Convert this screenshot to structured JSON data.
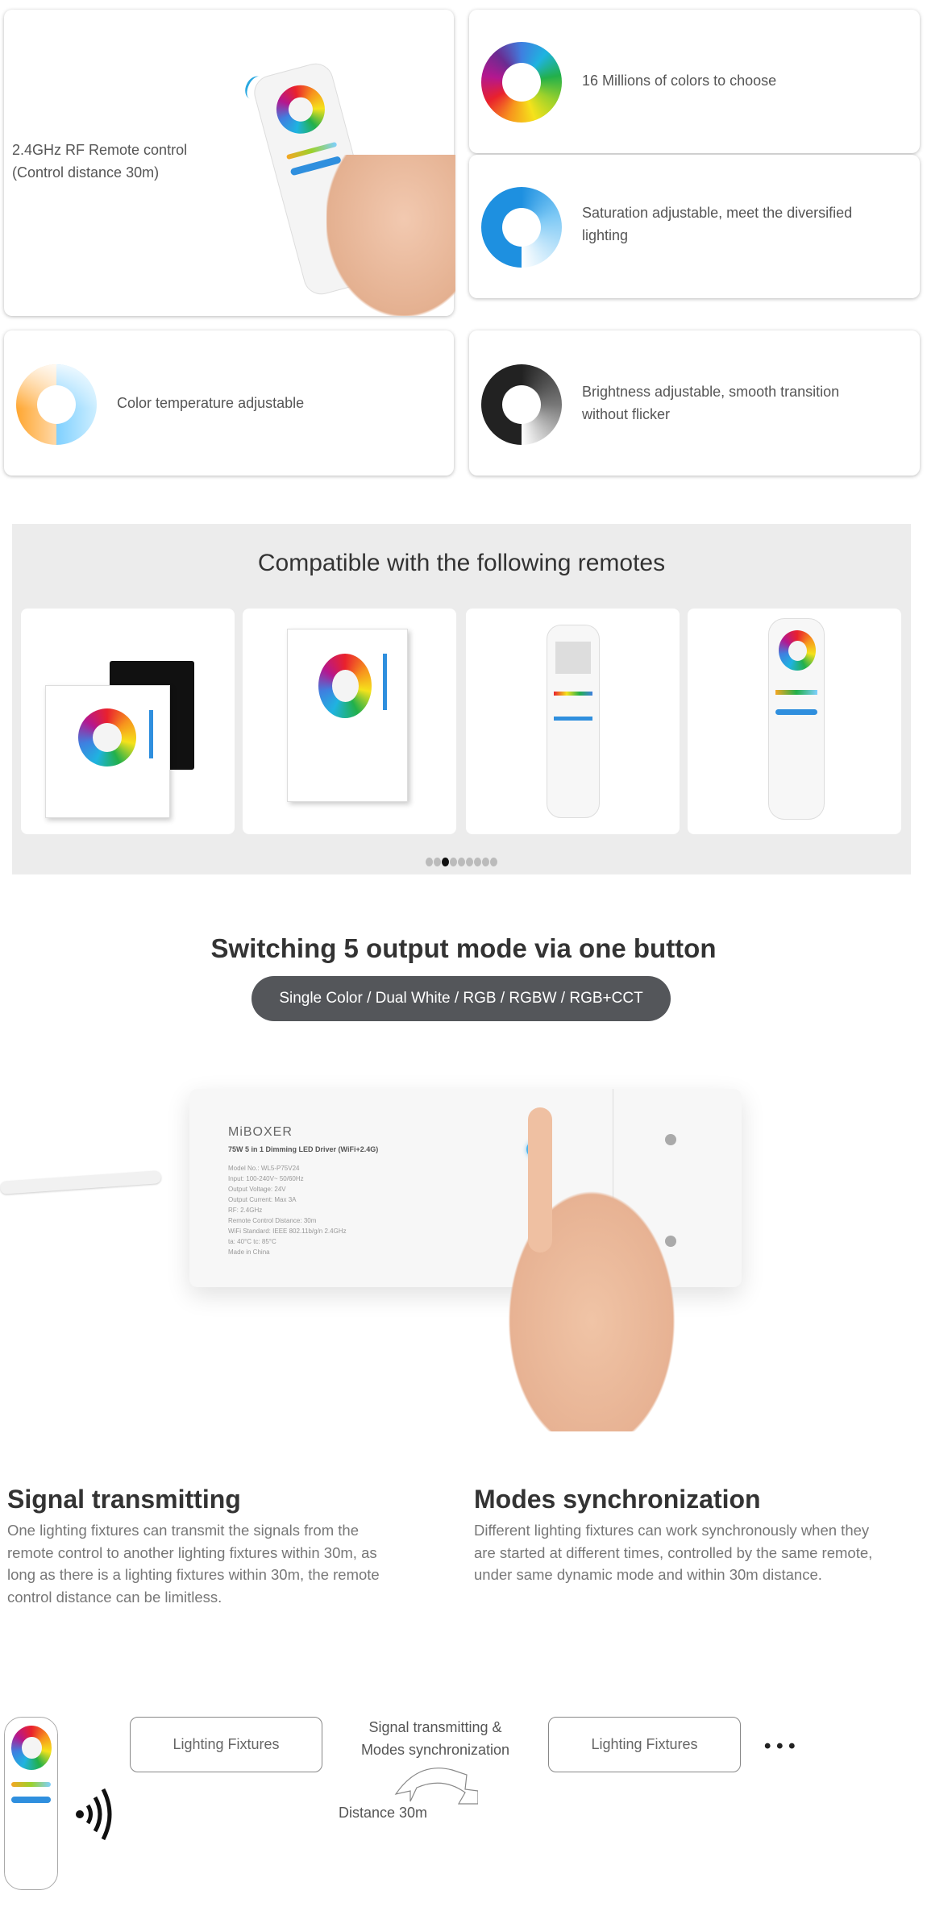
{
  "features": [
    {
      "text_line1": "2.4GHz RF Remote control",
      "text_line2": "(Control distance 30m)",
      "icon": "remote-hand-image"
    },
    {
      "text": "16 Millions of colors to choose",
      "icon": "rgb-color-ring-icon"
    },
    {
      "text_line1": "Saturation adjustable, meet the diversified",
      "text_line2": "lighting",
      "icon": "saturation-ring-icon"
    },
    {
      "text": "Color temperature adjustable",
      "icon": "color-temperature-ring-icon"
    },
    {
      "text_line1": "Brightness adjustable, smooth transition",
      "text_line2": "without flicker",
      "icon": "brightness-ring-icon"
    }
  ],
  "compatible": {
    "title": "Compatible with the following remotes",
    "total_slides": 9,
    "active_slide": 3
  },
  "modes": {
    "title": "Switching 5 output mode via one button",
    "pill": "Single Color / Dual White / RGB / RGBW / RGB+CCT"
  },
  "product": {
    "brand": "MiBOXER",
    "model_title": "75W 5 in 1 Dimming LED Driver (WiFi+2.4G)",
    "specs": [
      "Model No.: WL5-P75V24",
      "Input: 100-240V~ 50/60Hz",
      "Output Voltage: 24V",
      "Output Current: Max 3A",
      "RF: 2.4GHz",
      "Remote Control Distance: 30m",
      "WiFi Standard: IEEE 802.11b/g/n 2.4GHz",
      "ta: 40°C  tc: 85°C",
      "Made in China"
    ]
  },
  "signal": {
    "title": "Signal transmitting",
    "lines": [
      "One lighting fixtures can transmit the signals from the",
      "remote control to another lighting fixtures within 30m, as",
      "long as there is a lighting fixtures within 30m, the remote",
      "control distance can be limitless."
    ]
  },
  "sync": {
    "title": "Modes synchronization",
    "lines": [
      "Different lighting fixtures can work synchronously when they",
      "are started at different times, controlled by the same remote,",
      "under same dynamic mode and within 30m distance."
    ]
  },
  "diagram": {
    "box1": "Lighting Fixtures",
    "box2": "Lighting Fixtures",
    "center_line1": "Signal transmitting &",
    "center_line2": "Modes synchronization",
    "distance": "Distance 30m",
    "more": "• • •"
  },
  "colors": {
    "pill_bg": "#54565a",
    "panel_bg": "#ececec",
    "accent_blue": "#1e90e0"
  }
}
